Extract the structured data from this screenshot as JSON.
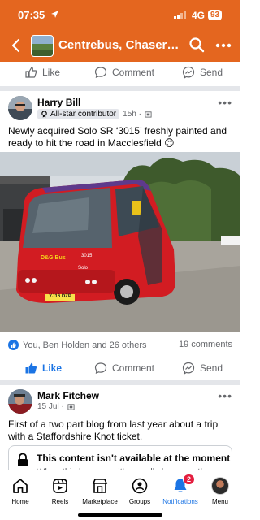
{
  "status_bar": {
    "time": "07:35",
    "network": "4G",
    "battery": "93"
  },
  "header": {
    "title": "Centrebus, Chaserid..."
  },
  "actions": {
    "like": "Like",
    "comment": "Comment",
    "send": "Send"
  },
  "post1": {
    "author": "Harry Bill",
    "badge": "All-star contributor",
    "time": "15h ·",
    "text": "Newly acquired Solo SR ‘3015’ freshly painted and ready to hit the road in Macclesfield 😊",
    "reactions": "You, Ben Holden and 26 others",
    "comments": "19 comments",
    "photo": {
      "bus_dest": "D&G Bus",
      "fleet_no": "3015",
      "plate": "YJ16 DZP",
      "model": "Solo"
    }
  },
  "post2": {
    "author": "Mark Fitchew",
    "time": "15 Jul ·",
    "text": "First of a two part blog from last year about a trip with a Staffordshire Knot ticket.",
    "unavailable_title": "This content isn't available at the moment",
    "unavailable_sub": "When this happens, it's usually because the..."
  },
  "nav": {
    "items": [
      {
        "label": "Home",
        "icon": "home-icon"
      },
      {
        "label": "Reels",
        "icon": "reels-icon"
      },
      {
        "label": "Marketplace",
        "icon": "marketplace-icon"
      },
      {
        "label": "Groups",
        "icon": "groups-icon"
      },
      {
        "label": "Notifications",
        "icon": "bell-icon",
        "badge": "2"
      },
      {
        "label": "Menu",
        "icon": "menu-avatar"
      }
    ]
  },
  "colors": {
    "brand_header": "#e4661f",
    "facebook_blue": "#1b74e4",
    "badge_red": "#e41e3f"
  }
}
